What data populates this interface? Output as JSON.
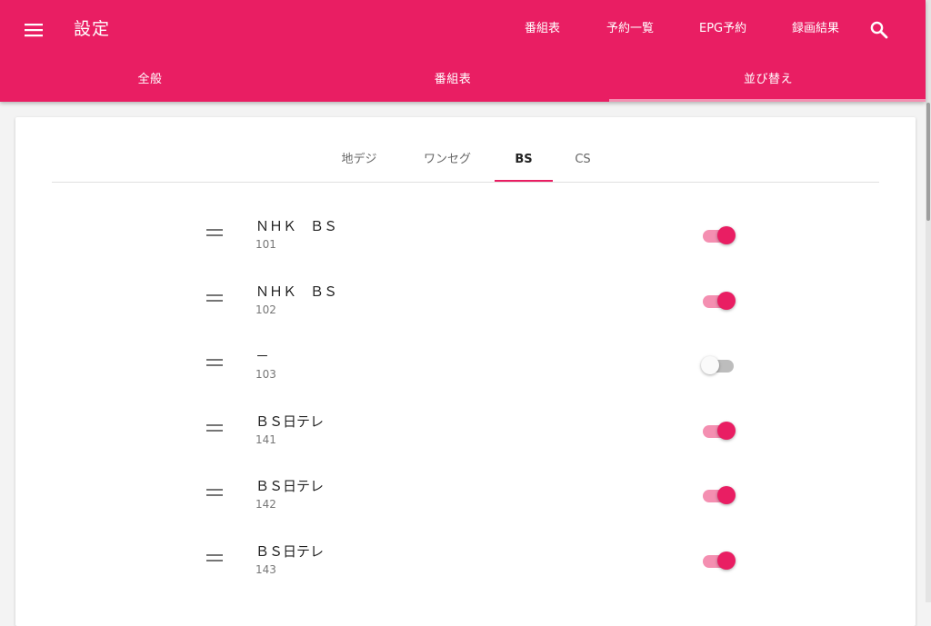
{
  "header": {
    "title": "設定",
    "nav": [
      "番組表",
      "予約一覧",
      "EPG予約",
      "録画結果"
    ]
  },
  "tabs": [
    {
      "label": "全般",
      "active": false
    },
    {
      "label": "番組表",
      "active": false
    },
    {
      "label": "並び替え",
      "active": true
    }
  ],
  "subtabs": [
    {
      "label": "地デジ",
      "active": false
    },
    {
      "label": "ワンセグ",
      "active": false
    },
    {
      "label": "BS",
      "active": true
    },
    {
      "label": "CS",
      "active": false
    }
  ],
  "channels": [
    {
      "name": "ＮＨＫ　ＢＳ",
      "number": "101",
      "enabled": true
    },
    {
      "name": "ＮＨＫ　ＢＳ",
      "number": "102",
      "enabled": true
    },
    {
      "name": "－",
      "number": "103",
      "enabled": false
    },
    {
      "name": "ＢＳ日テレ",
      "number": "141",
      "enabled": true
    },
    {
      "name": "ＢＳ日テレ",
      "number": "142",
      "enabled": true
    },
    {
      "name": "ＢＳ日テレ",
      "number": "143",
      "enabled": true
    }
  ],
  "colors": {
    "primary": "#e91e63",
    "primary_light": "#f48fb1",
    "switch_off_track": "#bdbdbd"
  },
  "icons": {
    "menu": "menu-icon",
    "search": "search-icon",
    "drag": "drag-handle-icon"
  }
}
